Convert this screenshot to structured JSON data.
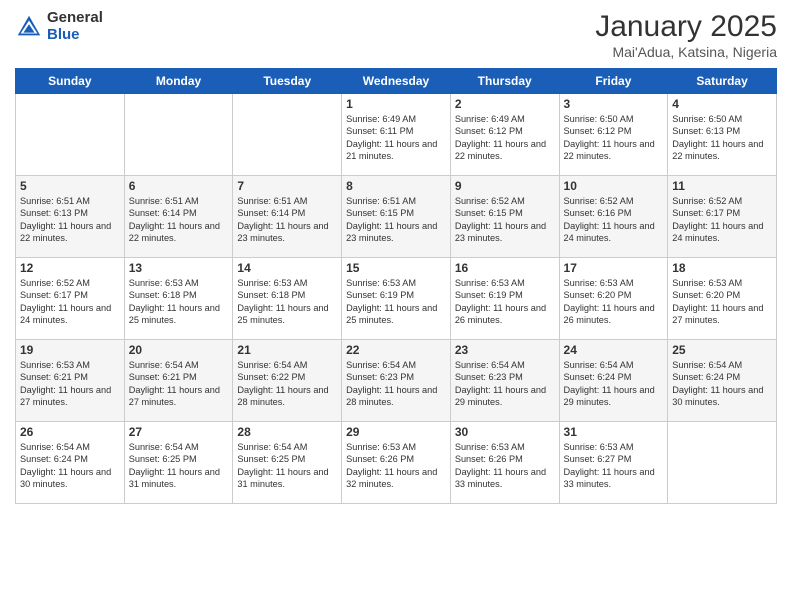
{
  "header": {
    "logo_general": "General",
    "logo_blue": "Blue",
    "title": "January 2025",
    "subtitle": "Mai'Adua, Katsina, Nigeria"
  },
  "days_of_week": [
    "Sunday",
    "Monday",
    "Tuesday",
    "Wednesday",
    "Thursday",
    "Friday",
    "Saturday"
  ],
  "weeks": [
    [
      {
        "day": "",
        "info": ""
      },
      {
        "day": "",
        "info": ""
      },
      {
        "day": "",
        "info": ""
      },
      {
        "day": "1",
        "info": "Sunrise: 6:49 AM\nSunset: 6:11 PM\nDaylight: 11 hours and 21 minutes."
      },
      {
        "day": "2",
        "info": "Sunrise: 6:49 AM\nSunset: 6:12 PM\nDaylight: 11 hours and 22 minutes."
      },
      {
        "day": "3",
        "info": "Sunrise: 6:50 AM\nSunset: 6:12 PM\nDaylight: 11 hours and 22 minutes."
      },
      {
        "day": "4",
        "info": "Sunrise: 6:50 AM\nSunset: 6:13 PM\nDaylight: 11 hours and 22 minutes."
      }
    ],
    [
      {
        "day": "5",
        "info": "Sunrise: 6:51 AM\nSunset: 6:13 PM\nDaylight: 11 hours and 22 minutes."
      },
      {
        "day": "6",
        "info": "Sunrise: 6:51 AM\nSunset: 6:14 PM\nDaylight: 11 hours and 22 minutes."
      },
      {
        "day": "7",
        "info": "Sunrise: 6:51 AM\nSunset: 6:14 PM\nDaylight: 11 hours and 23 minutes."
      },
      {
        "day": "8",
        "info": "Sunrise: 6:51 AM\nSunset: 6:15 PM\nDaylight: 11 hours and 23 minutes."
      },
      {
        "day": "9",
        "info": "Sunrise: 6:52 AM\nSunset: 6:15 PM\nDaylight: 11 hours and 23 minutes."
      },
      {
        "day": "10",
        "info": "Sunrise: 6:52 AM\nSunset: 6:16 PM\nDaylight: 11 hours and 24 minutes."
      },
      {
        "day": "11",
        "info": "Sunrise: 6:52 AM\nSunset: 6:17 PM\nDaylight: 11 hours and 24 minutes."
      }
    ],
    [
      {
        "day": "12",
        "info": "Sunrise: 6:52 AM\nSunset: 6:17 PM\nDaylight: 11 hours and 24 minutes."
      },
      {
        "day": "13",
        "info": "Sunrise: 6:53 AM\nSunset: 6:18 PM\nDaylight: 11 hours and 25 minutes."
      },
      {
        "day": "14",
        "info": "Sunrise: 6:53 AM\nSunset: 6:18 PM\nDaylight: 11 hours and 25 minutes."
      },
      {
        "day": "15",
        "info": "Sunrise: 6:53 AM\nSunset: 6:19 PM\nDaylight: 11 hours and 25 minutes."
      },
      {
        "day": "16",
        "info": "Sunrise: 6:53 AM\nSunset: 6:19 PM\nDaylight: 11 hours and 26 minutes."
      },
      {
        "day": "17",
        "info": "Sunrise: 6:53 AM\nSunset: 6:20 PM\nDaylight: 11 hours and 26 minutes."
      },
      {
        "day": "18",
        "info": "Sunrise: 6:53 AM\nSunset: 6:20 PM\nDaylight: 11 hours and 27 minutes."
      }
    ],
    [
      {
        "day": "19",
        "info": "Sunrise: 6:53 AM\nSunset: 6:21 PM\nDaylight: 11 hours and 27 minutes."
      },
      {
        "day": "20",
        "info": "Sunrise: 6:54 AM\nSunset: 6:21 PM\nDaylight: 11 hours and 27 minutes."
      },
      {
        "day": "21",
        "info": "Sunrise: 6:54 AM\nSunset: 6:22 PM\nDaylight: 11 hours and 28 minutes."
      },
      {
        "day": "22",
        "info": "Sunrise: 6:54 AM\nSunset: 6:23 PM\nDaylight: 11 hours and 28 minutes."
      },
      {
        "day": "23",
        "info": "Sunrise: 6:54 AM\nSunset: 6:23 PM\nDaylight: 11 hours and 29 minutes."
      },
      {
        "day": "24",
        "info": "Sunrise: 6:54 AM\nSunset: 6:24 PM\nDaylight: 11 hours and 29 minutes."
      },
      {
        "day": "25",
        "info": "Sunrise: 6:54 AM\nSunset: 6:24 PM\nDaylight: 11 hours and 30 minutes."
      }
    ],
    [
      {
        "day": "26",
        "info": "Sunrise: 6:54 AM\nSunset: 6:24 PM\nDaylight: 11 hours and 30 minutes."
      },
      {
        "day": "27",
        "info": "Sunrise: 6:54 AM\nSunset: 6:25 PM\nDaylight: 11 hours and 31 minutes."
      },
      {
        "day": "28",
        "info": "Sunrise: 6:54 AM\nSunset: 6:25 PM\nDaylight: 11 hours and 31 minutes."
      },
      {
        "day": "29",
        "info": "Sunrise: 6:53 AM\nSunset: 6:26 PM\nDaylight: 11 hours and 32 minutes."
      },
      {
        "day": "30",
        "info": "Sunrise: 6:53 AM\nSunset: 6:26 PM\nDaylight: 11 hours and 33 minutes."
      },
      {
        "day": "31",
        "info": "Sunrise: 6:53 AM\nSunset: 6:27 PM\nDaylight: 11 hours and 33 minutes."
      },
      {
        "day": "",
        "info": ""
      }
    ]
  ]
}
